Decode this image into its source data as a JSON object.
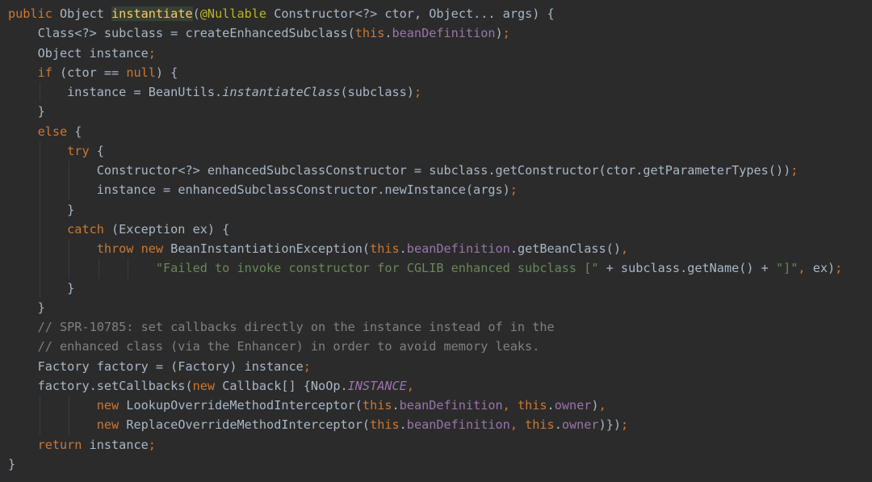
{
  "editor": {
    "colors": {
      "background": "#2b2b2b",
      "keyword": "#cc7832",
      "default": "#a9b7c6",
      "method_declaration": "#ffc66d",
      "annotation": "#bbb529",
      "field": "#9876aa",
      "string": "#6a8759",
      "comment": "#808080"
    },
    "lines": [
      {
        "indent": 0,
        "tokens": [
          {
            "t": "kw",
            "s": "public"
          },
          {
            "t": "plain",
            "s": " Object "
          },
          {
            "t": "fn",
            "s": "instantiate"
          },
          {
            "t": "plain",
            "s": "("
          },
          {
            "t": "anno",
            "s": "@Nullable"
          },
          {
            "t": "plain",
            "s": " Constructor<?> ctor, Object... args) {"
          }
        ]
      },
      {
        "indent": 1,
        "tokens": [
          {
            "t": "plain",
            "s": "Class<?> subclass = createEnhancedSubclass("
          },
          {
            "t": "kw",
            "s": "this"
          },
          {
            "t": "plain",
            "s": "."
          },
          {
            "t": "field",
            "s": "beanDefinition"
          },
          {
            "t": "plain",
            "s": ")"
          },
          {
            "t": "kw",
            "s": ";"
          }
        ]
      },
      {
        "indent": 1,
        "tokens": [
          {
            "t": "plain",
            "s": "Object instance"
          },
          {
            "t": "kw",
            "s": ";"
          }
        ]
      },
      {
        "indent": 1,
        "tokens": [
          {
            "t": "kw",
            "s": "if"
          },
          {
            "t": "plain",
            "s": " (ctor == "
          },
          {
            "t": "kw",
            "s": "null"
          },
          {
            "t": "plain",
            "s": ") {"
          }
        ]
      },
      {
        "indent": 2,
        "tokens": [
          {
            "t": "plain",
            "s": "instance = BeanUtils."
          },
          {
            "t": "static",
            "s": "instantiateClass"
          },
          {
            "t": "plain",
            "s": "(subclass)"
          },
          {
            "t": "kw",
            "s": ";"
          }
        ]
      },
      {
        "indent": 1,
        "tokens": [
          {
            "t": "plain",
            "s": "}"
          }
        ]
      },
      {
        "indent": 1,
        "tokens": [
          {
            "t": "kw",
            "s": "else"
          },
          {
            "t": "plain",
            "s": " {"
          }
        ]
      },
      {
        "indent": 2,
        "tokens": [
          {
            "t": "kw",
            "s": "try"
          },
          {
            "t": "plain",
            "s": " {"
          }
        ]
      },
      {
        "indent": 3,
        "tokens": [
          {
            "t": "plain",
            "s": "Constructor<?> enhancedSubclassConstructor = subclass.getConstructor(ctor.getParameterTypes())"
          },
          {
            "t": "kw",
            "s": ";"
          }
        ]
      },
      {
        "indent": 3,
        "tokens": [
          {
            "t": "plain",
            "s": "instance = enhancedSubclassConstructor.newInstance(args)"
          },
          {
            "t": "kw",
            "s": ";"
          }
        ]
      },
      {
        "indent": 2,
        "tokens": [
          {
            "t": "plain",
            "s": "}"
          }
        ]
      },
      {
        "indent": 2,
        "tokens": [
          {
            "t": "kw",
            "s": "catch"
          },
          {
            "t": "plain",
            "s": " (Exception ex) {"
          }
        ]
      },
      {
        "indent": 3,
        "tokens": [
          {
            "t": "kw",
            "s": "throw new"
          },
          {
            "t": "plain",
            "s": " BeanInstantiationException("
          },
          {
            "t": "kw",
            "s": "this"
          },
          {
            "t": "plain",
            "s": "."
          },
          {
            "t": "field",
            "s": "beanDefinition"
          },
          {
            "t": "plain",
            "s": ".getBeanClass()"
          },
          {
            "t": "kw",
            "s": ","
          }
        ]
      },
      {
        "indent": 5,
        "tokens": [
          {
            "t": "str",
            "s": "\"Failed to invoke constructor for CGLIB enhanced subclass [\""
          },
          {
            "t": "plain",
            "s": " + subclass.getName() + "
          },
          {
            "t": "str",
            "s": "\"]\""
          },
          {
            "t": "kw",
            "s": ","
          },
          {
            "t": "plain",
            "s": " ex)"
          },
          {
            "t": "kw",
            "s": ";"
          }
        ]
      },
      {
        "indent": 2,
        "tokens": [
          {
            "t": "plain",
            "s": "}"
          }
        ]
      },
      {
        "indent": 1,
        "tokens": [
          {
            "t": "plain",
            "s": "}"
          }
        ]
      },
      {
        "indent": 1,
        "tokens": [
          {
            "t": "comment",
            "s": "// SPR-10785: set callbacks directly on the instance instead of in the"
          }
        ]
      },
      {
        "indent": 1,
        "tokens": [
          {
            "t": "comment",
            "s": "// enhanced class (via the Enhancer) in order to avoid memory leaks."
          }
        ]
      },
      {
        "indent": 1,
        "tokens": [
          {
            "t": "plain",
            "s": "Factory factory = (Factory) instance"
          },
          {
            "t": "kw",
            "s": ";"
          }
        ]
      },
      {
        "indent": 1,
        "tokens": [
          {
            "t": "plain",
            "s": "factory.setCallbacks("
          },
          {
            "t": "kw",
            "s": "new"
          },
          {
            "t": "plain",
            "s": " Callback[] {NoOp."
          },
          {
            "t": "ifield",
            "s": "INSTANCE"
          },
          {
            "t": "kw",
            "s": ","
          }
        ]
      },
      {
        "indent": 3,
        "tokens": [
          {
            "t": "kw",
            "s": "new"
          },
          {
            "t": "plain",
            "s": " LookupOverrideMethodInterceptor("
          },
          {
            "t": "kw",
            "s": "this"
          },
          {
            "t": "plain",
            "s": "."
          },
          {
            "t": "field",
            "s": "beanDefinition"
          },
          {
            "t": "kw",
            "s": ", this"
          },
          {
            "t": "plain",
            "s": "."
          },
          {
            "t": "field",
            "s": "owner"
          },
          {
            "t": "plain",
            "s": ")"
          },
          {
            "t": "kw",
            "s": ","
          }
        ]
      },
      {
        "indent": 3,
        "tokens": [
          {
            "t": "kw",
            "s": "new"
          },
          {
            "t": "plain",
            "s": " ReplaceOverrideMethodInterceptor("
          },
          {
            "t": "kw",
            "s": "this"
          },
          {
            "t": "plain",
            "s": "."
          },
          {
            "t": "field",
            "s": "beanDefinition"
          },
          {
            "t": "kw",
            "s": ", this"
          },
          {
            "t": "plain",
            "s": "."
          },
          {
            "t": "field",
            "s": "owner"
          },
          {
            "t": "plain",
            "s": ")})"
          },
          {
            "t": "kw",
            "s": ";"
          }
        ]
      },
      {
        "indent": 1,
        "tokens": [
          {
            "t": "kw",
            "s": "return"
          },
          {
            "t": "plain",
            "s": " instance"
          },
          {
            "t": "kw",
            "s": ";"
          }
        ]
      },
      {
        "indent": 0,
        "tokens": [
          {
            "t": "plain",
            "s": "}"
          }
        ]
      }
    ]
  }
}
